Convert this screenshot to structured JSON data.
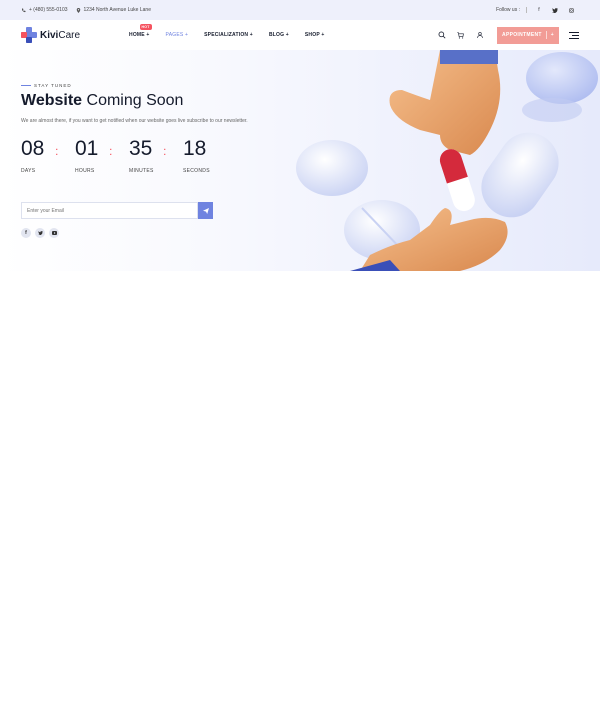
{
  "topbar": {
    "phone": "+ (480) 555-0103",
    "address": "1234 North Avenue Luke Lane",
    "follow_label": "Follow us :",
    "social_icons": [
      "facebook-icon",
      "twitter-icon",
      "instagram-icon"
    ]
  },
  "header": {
    "logo": {
      "part1": "Kivi",
      "part2": "Care",
      "brand_color": "#6f83e0",
      "accent_color": "#f5535f"
    },
    "nav": [
      {
        "label": "HOME +",
        "badge": "HOT"
      },
      {
        "label": "PAGES +"
      },
      {
        "label": "SPECIALIZATION +"
      },
      {
        "label": "BLOG +"
      },
      {
        "label": "SHOP +"
      }
    ],
    "appointment_label": "APPOINTMENT",
    "appointment_plus": "+"
  },
  "hero": {
    "eyebrow": "STAY TUNED",
    "title_bold": "Website",
    "title_rest": " Coming Soon",
    "subtitle": "We are almost there, if you want to get notified when our website goes live subscribe to our newsletter.",
    "countdown": [
      {
        "value": "08",
        "label": "DAYS"
      },
      {
        "value": "01",
        "label": "HOURS"
      },
      {
        "value": "35",
        "label": "MINUTES"
      },
      {
        "value": "18",
        "label": "SECONDS"
      }
    ],
    "email_placeholder": "Enter your Email",
    "social_icons": [
      "facebook-icon",
      "twitter-icon",
      "youtube-icon"
    ]
  },
  "colors": {
    "primary": "#6f83e0",
    "secondary": "#f5535f",
    "appointment": "#f29c96",
    "dark": "#151b2c"
  }
}
